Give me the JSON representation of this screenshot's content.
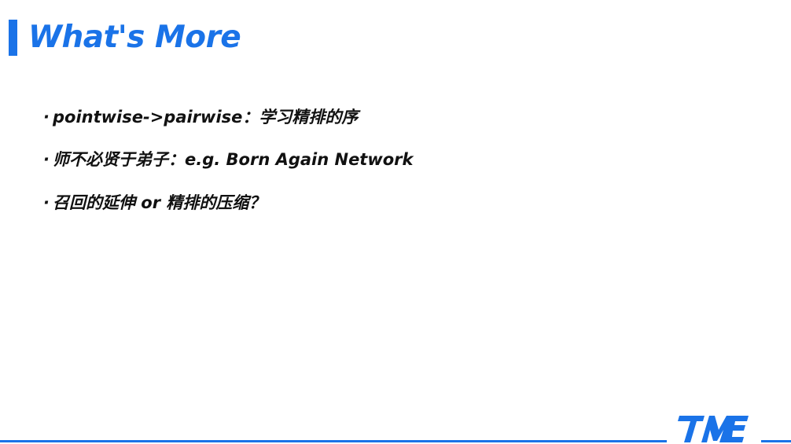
{
  "slide": {
    "title": "What's More",
    "bullet_marker": "·",
    "bullets": [
      "pointwise->pairwise：学习精排的序",
      "师不必贤于弟子：e.g. Born Again Network",
      "召回的延伸 or 精排的压缩？"
    ]
  },
  "logo": {
    "icon": "tme-logo-icon",
    "color": "#1a73e8"
  },
  "colors": {
    "accent": "#1a73e8",
    "text": "#111111",
    "background": "#ffffff"
  }
}
